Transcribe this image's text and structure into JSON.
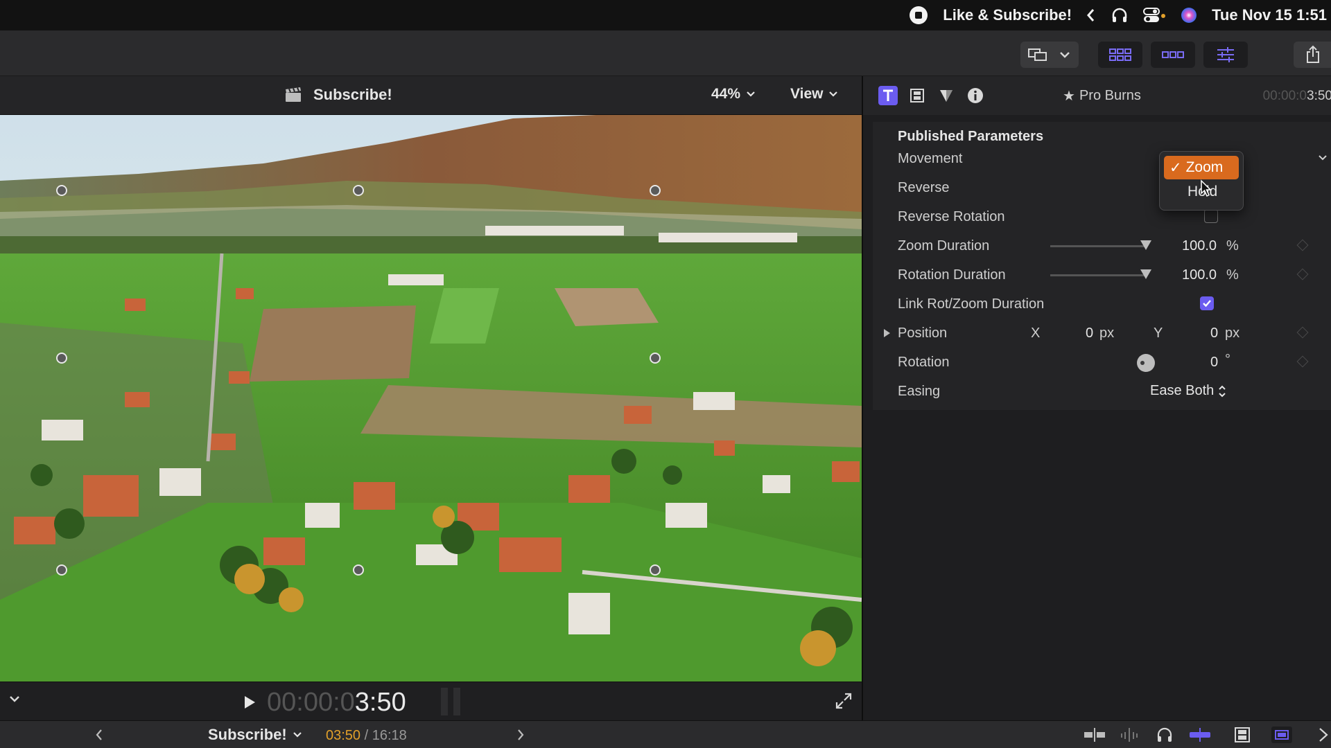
{
  "menubar": {
    "title": "Like & Subscribe!",
    "datetime": "Tue Nov 15  1:51"
  },
  "viewer": {
    "clip_name": "Subscribe!",
    "zoom": "44%",
    "view_label": "View",
    "timecode_dim": "00:00:0",
    "timecode_bright": "3:50"
  },
  "inspector": {
    "effect_name": "Pro Burns",
    "timecode_dim": "00:00:0",
    "timecode_bright": "3:50",
    "section_title": "Published Parameters",
    "params": {
      "movement": {
        "label": "Movement",
        "options": [
          "Zoom",
          "Hold"
        ],
        "selected": "Zoom",
        "hover_option": "Hold"
      },
      "reverse": {
        "label": "Reverse"
      },
      "reverse_rotation": {
        "label": "Reverse Rotation",
        "checked": false
      },
      "zoom_duration": {
        "label": "Zoom Duration",
        "value": "100.0",
        "unit": "%",
        "slider_percent": 100
      },
      "rotation_duration": {
        "label": "Rotation Duration",
        "value": "100.0",
        "unit": "%",
        "slider_percent": 100
      },
      "link_duration": {
        "label": "Link Rot/Zoom Duration",
        "checked": true
      },
      "position": {
        "label": "Position",
        "x_label": "X",
        "x_value": "0",
        "x_unit": "px",
        "y_label": "Y",
        "y_value": "0",
        "y_unit": "px"
      },
      "rotation": {
        "label": "Rotation",
        "value": "0",
        "unit": "°"
      },
      "easing": {
        "label": "Easing",
        "value": "Ease Both"
      }
    }
  },
  "timeline_bar": {
    "project_name": "Subscribe!",
    "current_time": "03:50",
    "total_time": "/ 16:18"
  },
  "colors": {
    "accent_purple": "#6b5cf0",
    "menu_selected": "#d96a1e",
    "timecode_orange": "#e2a02a"
  }
}
